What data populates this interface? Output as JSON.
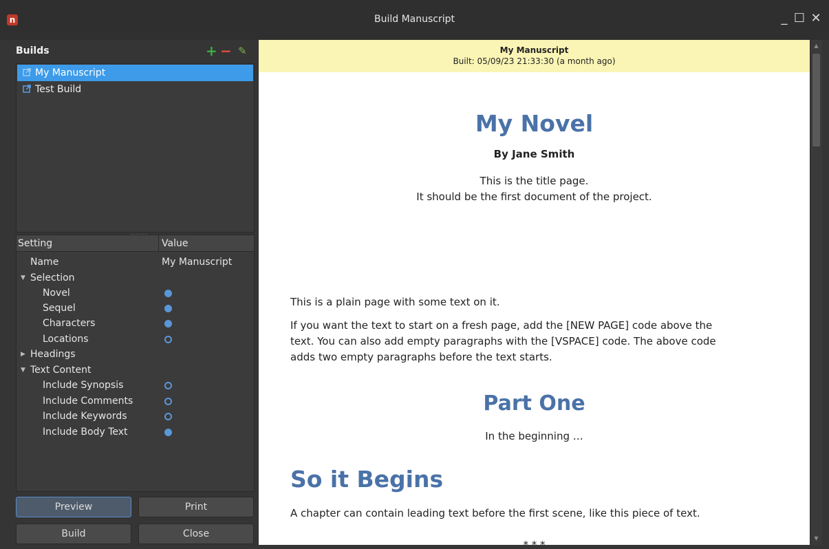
{
  "window": {
    "title": "Build Manuscript",
    "app_icon": "n",
    "controls": {
      "minimize": "_",
      "maximize": "☐",
      "close": "✕"
    }
  },
  "builds": {
    "title": "Builds",
    "add": "+",
    "remove": "−",
    "edit": "✎",
    "items": [
      {
        "label": "My Manuscript",
        "selected": true
      },
      {
        "label": "Test Build",
        "selected": false
      }
    ]
  },
  "settings": {
    "col_setting": "Setting",
    "col_value": "Value",
    "rows": {
      "name": {
        "label": "Name",
        "value": "My Manuscript"
      },
      "selection": {
        "label": "Selection",
        "arrow": "▼"
      },
      "novel": {
        "label": "Novel"
      },
      "sequel": {
        "label": "Sequel"
      },
      "characters": {
        "label": "Characters"
      },
      "locations": {
        "label": "Locations"
      },
      "headings": {
        "label": "Headings",
        "arrow": "▶"
      },
      "text_content": {
        "label": "Text Content",
        "arrow": "▼"
      },
      "synopsis": {
        "label": "Include Synopsis"
      },
      "comments": {
        "label": "Include Comments"
      },
      "keywords": {
        "label": "Include Keywords"
      },
      "body": {
        "label": "Include Body Text"
      }
    }
  },
  "buttons": {
    "preview": "Preview",
    "print": "Print",
    "build": "Build",
    "close": "Close"
  },
  "preview": {
    "banner_title": "My Manuscript",
    "banner_built": "Built: 05/09/23 21:33:30 (a month ago)",
    "title": "My Novel",
    "byline": "By Jane Smith",
    "title_line1": "This is the title page.",
    "title_line2": "It should be the first document of the project.",
    "plain": "This is a plain page with some text on it.",
    "para2_l1": "If you want the text to start on a fresh page, add the [NEW PAGE] code above the",
    "para2_l2": "text. You can also add empty paragraphs with the [VSPACE] code. The above code",
    "para2_l3": "adds two empty paragraphs before the text starts.",
    "part": "Part One",
    "part_sub": "In the beginning …",
    "chapter": "So it Begins",
    "chapter_text": "A chapter can contain leading text before the first scene, like this piece of text.",
    "sep": "* * *"
  },
  "colors": {
    "accent": "#3d9be9",
    "heading": "#4a72a8",
    "banner": "#fbf5b5",
    "add": "#3cb043",
    "remove": "#e74c3c",
    "edit": "#7fb24a"
  }
}
